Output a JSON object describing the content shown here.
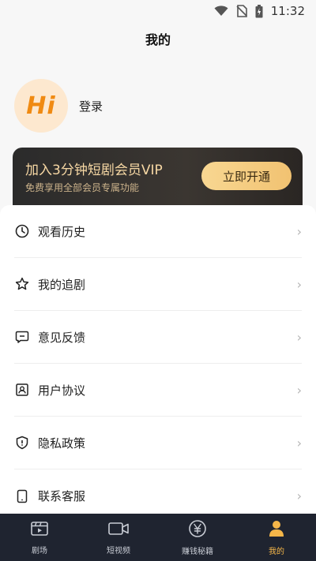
{
  "status_bar": {
    "time": "11:32"
  },
  "header": {
    "title": "我的"
  },
  "profile": {
    "avatar_text": "Hi",
    "login_label": "登录"
  },
  "vip": {
    "title": "加入3分钟短剧会员VIP",
    "subtitle": "免费享用全部会员专属功能",
    "button_label": "立即开通"
  },
  "menu": [
    {
      "label": "观看历史",
      "icon": "clock-icon"
    },
    {
      "label": "我的追剧",
      "icon": "star-icon"
    },
    {
      "label": "意见反馈",
      "icon": "chat-icon"
    },
    {
      "label": "用户协议",
      "icon": "user-card-icon"
    },
    {
      "label": "隐私政策",
      "icon": "shield-icon"
    },
    {
      "label": "联系客服",
      "icon": "phone-icon"
    }
  ],
  "tabs": [
    {
      "label": "剧场",
      "icon": "film-icon"
    },
    {
      "label": "短视频",
      "icon": "video-camera-icon"
    },
    {
      "label": "赚钱秘籍",
      "icon": "yen-icon"
    },
    {
      "label": "我的",
      "icon": "person-icon",
      "active": true
    }
  ],
  "colors": {
    "accent": "#f5b649",
    "vip_text": "#f7d8a4",
    "tabbar_bg": "#1f2430",
    "avatar_bg": "#fde8cf",
    "avatar_text": "#f08a12"
  }
}
